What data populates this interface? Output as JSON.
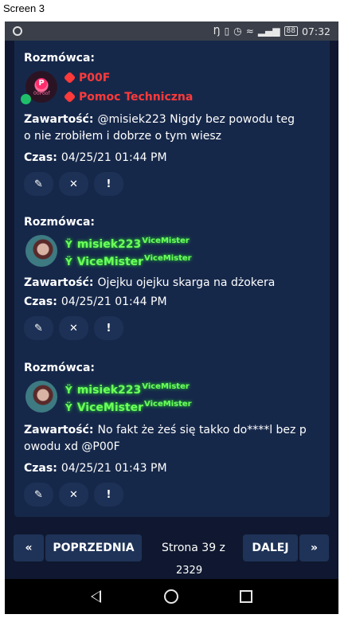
{
  "caption": "Screen 3",
  "status_bar": {
    "time": "07:32",
    "battery": "88"
  },
  "labels": {
    "interlocutor": "Rozmówca:",
    "content": "Zawartość:",
    "time": "Czas:"
  },
  "messages": [
    {
      "user": "P00F",
      "role": "Pomoc Techniczna",
      "avatar_text": "00Poof",
      "content_line1": "@misiek223 Nigdy bez powodu teg",
      "content_line2": "o nie zrobiłem i dobrze o tym wiesz",
      "time": "04/25/21 01:44 PM"
    },
    {
      "user": "misiek223",
      "user_tag": "ViceMister",
      "role": "ViceMister",
      "role_tag": "ViceMister",
      "content_line1": "Ojejku ojejku skarga na dżokera",
      "content_line2": "",
      "time": "04/25/21 01:44 PM"
    },
    {
      "user": "misiek223",
      "user_tag": "ViceMister",
      "role": "ViceMister",
      "role_tag": "ViceMister",
      "content_line1": "No fakt że żeś się takko do****l bez p",
      "content_line2": "owodu xd @P00F",
      "time": "04/25/21 01:43 PM"
    }
  ],
  "action_icons": {
    "edit": "✎",
    "delete": "✕",
    "report": "!"
  },
  "pagination": {
    "first_icon": "«",
    "prev_label": "POPRZEDNIA",
    "page_text": "Strona 39 z",
    "page_total": "2329",
    "next_label": "DALEJ",
    "last_icon": "»"
  }
}
